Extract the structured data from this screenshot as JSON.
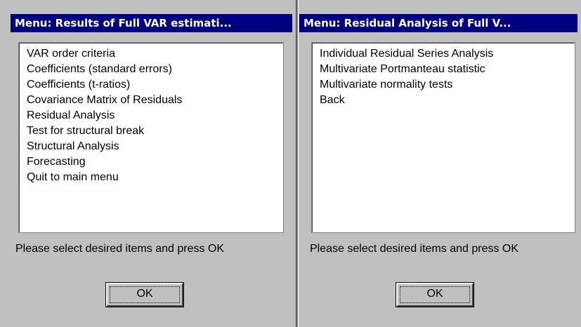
{
  "left_dialog": {
    "title": "Menu: Results of Full VAR estimati...",
    "items": [
      "VAR order criteria",
      "Coefficients (standard errors)",
      "Coefficients (t-ratios)",
      "Covariance Matrix of Residuals",
      "Residual Analysis",
      "Test for structural break",
      "Structural Analysis",
      "Forecasting",
      "Quit to main menu"
    ],
    "prompt": "Please select desired items and press OK",
    "ok_label": "OK"
  },
  "right_dialog": {
    "title": "Menu: Residual Analysis of Full V...",
    "items": [
      "Individual Residual Series Analysis",
      "Multivariate Portmanteau statistic",
      "Multivariate normality tests",
      "Back"
    ],
    "prompt": "Please select desired items and press OK",
    "ok_label": "OK"
  },
  "colors": {
    "titlebar": "#000080",
    "face": "#c0c0c0",
    "list_bg": "#ffffff"
  }
}
